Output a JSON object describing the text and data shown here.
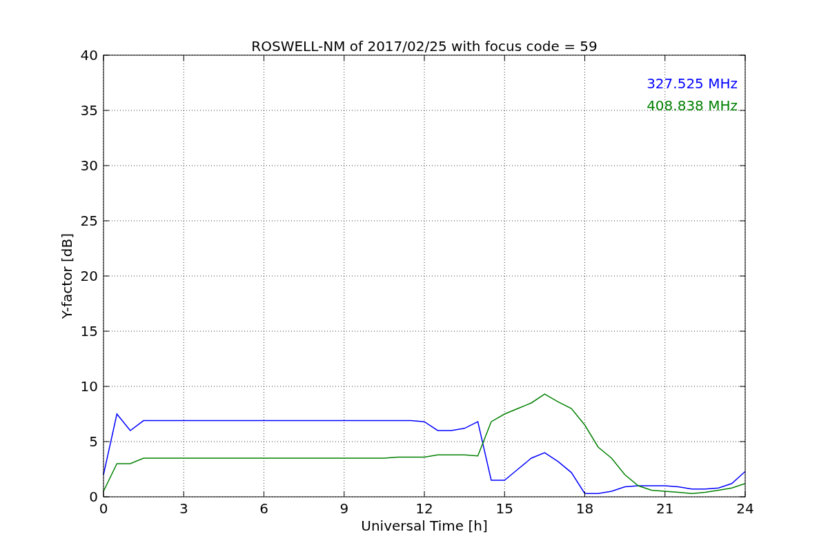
{
  "chart_data": {
    "type": "line",
    "title": "ROSWELL-NM of 2017/02/25 with focus code = 59",
    "xlabel": "Universal Time [h]",
    "ylabel": "Y-factor [dB]",
    "x": [
      0,
      0.5,
      1,
      1.5,
      2,
      2.5,
      3,
      3.5,
      4,
      4.5,
      5,
      5.5,
      6,
      6.5,
      7,
      7.5,
      8,
      8.5,
      9,
      9.5,
      10,
      10.5,
      11,
      11.5,
      12,
      12.5,
      13,
      13.5,
      14,
      14.5,
      15,
      15.5,
      16,
      16.5,
      17,
      17.5,
      18,
      18.5,
      19,
      19.5,
      20,
      20.5,
      21,
      21.5,
      22,
      22.5,
      23,
      23.5,
      24
    ],
    "series": [
      {
        "name": "327.525 MHz",
        "color": "#0000ff",
        "values": [
          2,
          7.5,
          6,
          6.9,
          6.9,
          6.9,
          6.9,
          6.9,
          6.9,
          6.9,
          6.9,
          6.9,
          6.9,
          6.9,
          6.9,
          6.9,
          6.9,
          6.9,
          6.9,
          6.9,
          6.9,
          6.9,
          6.9,
          6.9,
          6.8,
          6,
          6,
          6.2,
          6.8,
          1.5,
          1.5,
          2.5,
          3.5,
          4,
          3.2,
          2.2,
          0.3,
          0.3,
          0.5,
          0.9,
          1,
          1,
          1,
          0.9,
          0.7,
          0.7,
          0.8,
          1.2,
          2.3
        ]
      },
      {
        "name": "408.838 MHz",
        "color": "#008000",
        "values": [
          0.5,
          3,
          3,
          3.5,
          3.5,
          3.5,
          3.5,
          3.5,
          3.5,
          3.5,
          3.5,
          3.5,
          3.5,
          3.5,
          3.5,
          3.5,
          3.5,
          3.5,
          3.5,
          3.5,
          3.5,
          3.5,
          3.6,
          3.6,
          3.6,
          3.8,
          3.8,
          3.8,
          3.7,
          6.8,
          7.5,
          8,
          8.5,
          9.3,
          8.6,
          8,
          6.5,
          4.5,
          3.5,
          2,
          1,
          0.6,
          0.5,
          0.4,
          0.3,
          0.4,
          0.6,
          0.8,
          1.2
        ]
      }
    ],
    "grid": true,
    "xlim": [
      0,
      24
    ],
    "ylim": [
      0,
      40
    ],
    "xticks": [
      0,
      3,
      6,
      9,
      12,
      15,
      18,
      21,
      24
    ],
    "yticks": [
      0,
      5,
      10,
      15,
      20,
      25,
      30,
      35,
      40
    ]
  }
}
